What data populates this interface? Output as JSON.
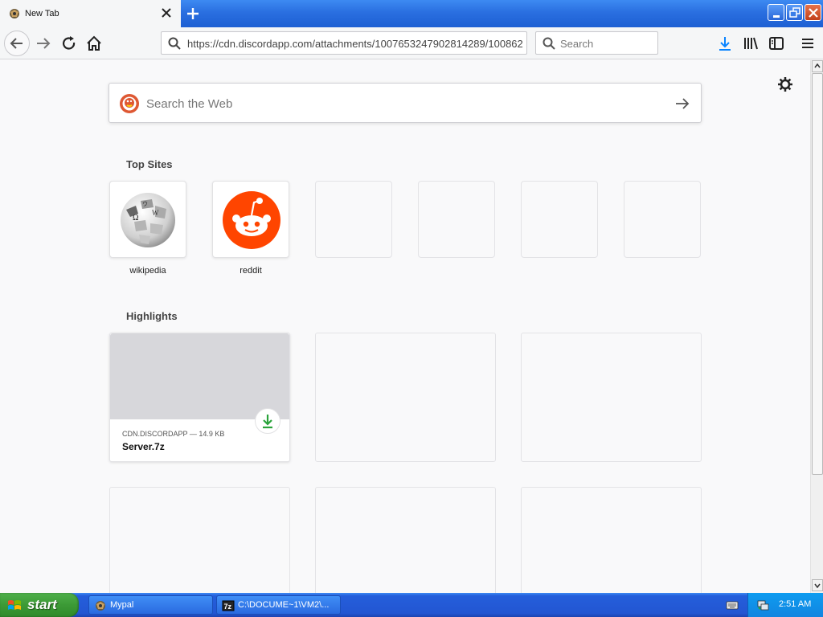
{
  "browser": {
    "tab_title": "New Tab",
    "url": "https://cdn.discordapp.com/attachments/1007653247902814289/100862",
    "search_placeholder": "Search"
  },
  "newtab": {
    "web_search_placeholder": "Search the Web",
    "top_sites_title": "Top Sites",
    "top_sites": [
      {
        "label": "wikipedia",
        "icon": "wikipedia-globe-icon"
      },
      {
        "label": "reddit",
        "icon": "reddit-icon"
      }
    ],
    "highlights_title": "Highlights",
    "highlight": {
      "meta": "CDN.DISCORDAPP — 14.9 KB",
      "title": "Server.7z"
    }
  },
  "taskbar": {
    "start_label": "start",
    "tasks": [
      {
        "label": "Mypal"
      },
      {
        "label": "C:\\DOCUME~1\\VM2\\..."
      }
    ],
    "clock": "2:51 AM"
  },
  "colors": {
    "taskbar_blue": "#245edb",
    "start_green": "#3c9a36",
    "download_green": "#2aa33b",
    "reddit_orange": "#ff4500",
    "ddg_orange": "#de5833"
  }
}
